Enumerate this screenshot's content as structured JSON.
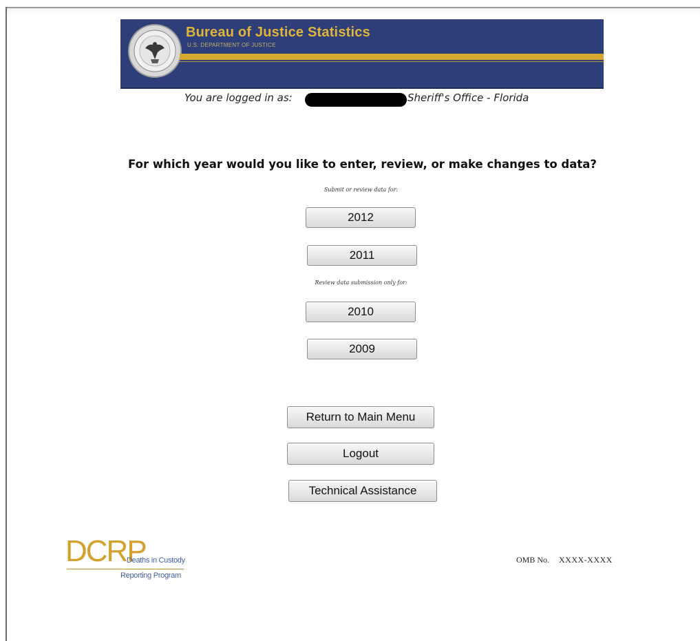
{
  "header": {
    "agency_title": "Bureau of Justice Statistics",
    "agency_subtitle": "U.S. DEPARTMENT OF JUSTICE",
    "seal_icon": "doj-seal-icon",
    "colors": {
      "banner": "#2e3e78",
      "gold": "#d4a92e"
    }
  },
  "login": {
    "label": "You are logged in as:",
    "agency": "Sheriff's Office - Florida"
  },
  "main": {
    "question": "For which year would you like to enter, review, or make changes to data?",
    "submit_note": "Submit or review data for:",
    "submit_years": [
      "2012",
      "2011"
    ],
    "review_note": "Review data submission only for:",
    "review_years": [
      "2010",
      "2009"
    ]
  },
  "actions": {
    "return_label": "Return to Main Menu",
    "logout_label": "Logout",
    "assist_label": "Technical Assistance"
  },
  "footer": {
    "logo_big": "DCRP",
    "logo_line1": "Deaths in Custody",
    "logo_line2": "Reporting Program",
    "omb_label": "OMB No.",
    "omb_value": "XXXX-XXXX",
    "logo_color": "#d4a12f"
  }
}
